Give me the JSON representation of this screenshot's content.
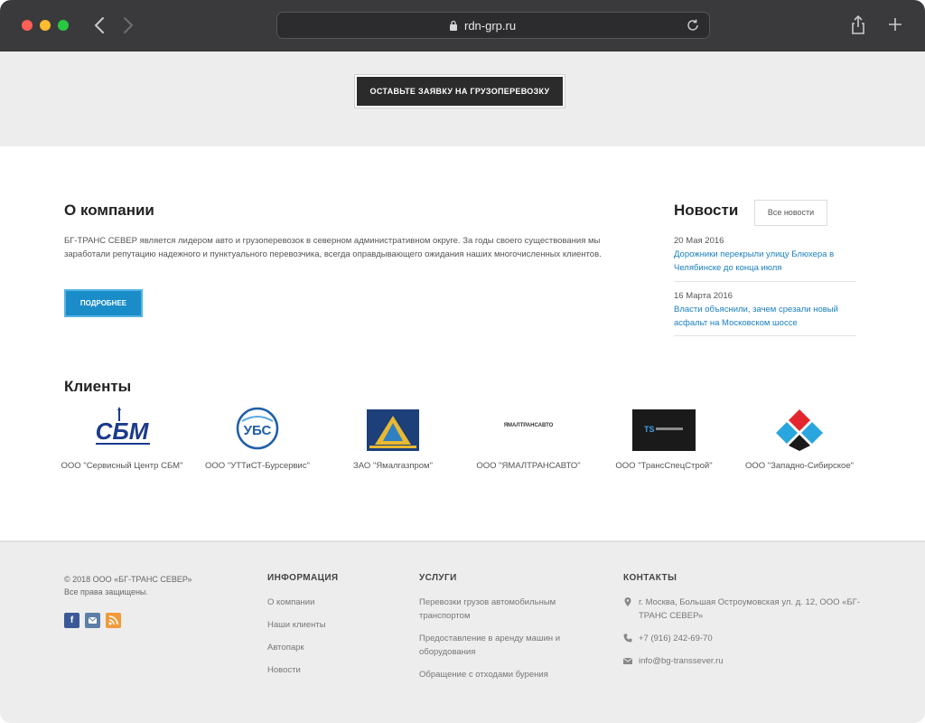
{
  "browser": {
    "url": "rdn-grp.ru"
  },
  "cta": {
    "label": "Оставьте заявку на грузоперевозку"
  },
  "about": {
    "title": "О компании",
    "text": "БГ-ТРАНС СЕВЕР является лидером авто и грузоперевозок в северном административном округе. За годы своего существования мы заработали репутацию надежного и пунктуального перевозчика, всегда оправдывающего ожидания наших многочисленных клиентов.",
    "more_label": "Подробнее"
  },
  "news": {
    "title": "Новости",
    "all_label": "Все новости",
    "items": [
      {
        "date": "20 Мая 2016",
        "text": "Дорожники перекрыли улицу Блюхера в Челябинске до конца июля"
      },
      {
        "date": "16 Марта 2016",
        "text": "Власти объяснили, зачем срезали новый асфальт на Московском шоссе"
      }
    ]
  },
  "clients": {
    "title": "Клиенты",
    "items": [
      {
        "name": "ООО \"Сервисный Центр СБМ\"",
        "logo_text": "СБМ"
      },
      {
        "name": "ООО \"УТТиСТ-Бурсервис\"",
        "logo_text": "УБС"
      },
      {
        "name": "ЗАО \"Ямалгазпром\"",
        "logo_text": ""
      },
      {
        "name": "ООО \"ЯМАЛТРАНСАВТО\"",
        "logo_text": "ЯМАЛТРАНСАВТО"
      },
      {
        "name": "ООО \"ТрансСпецСтрой\"",
        "logo_text": "TS"
      },
      {
        "name": "ООО \"Западно-Сибирское\"",
        "logo_text": ""
      }
    ]
  },
  "footer": {
    "copyright_line1": "© 2018 ООО «БГ-ТРАНС СЕВЕР»",
    "copyright_line2": "Все права защищены.",
    "info": {
      "title": "Информация",
      "links": [
        "О компании",
        "Наши клиенты",
        "Автопарк",
        "Новости"
      ]
    },
    "services": {
      "title": "Услуги",
      "links": [
        "Перевозки грузов автомобильным транспортом",
        "Предоставление в аренду машин и оборудования",
        "Обращение с отходами бурения"
      ]
    },
    "contacts": {
      "title": "Контакты",
      "address": "г. Москва, Большая Остроумовская ул. д. 12, ООО «БГ-ТРАНС СЕВЕР»",
      "phone": "+7 (916) 242-69-70",
      "email": "info@bg-transsever.ru"
    },
    "social_icons": [
      "facebook-icon",
      "vk-icon",
      "rss-icon"
    ]
  },
  "colors": {
    "accent": "#1a8cc7",
    "link": "#1a7fbf",
    "dark_button": "#2b2b2b"
  }
}
